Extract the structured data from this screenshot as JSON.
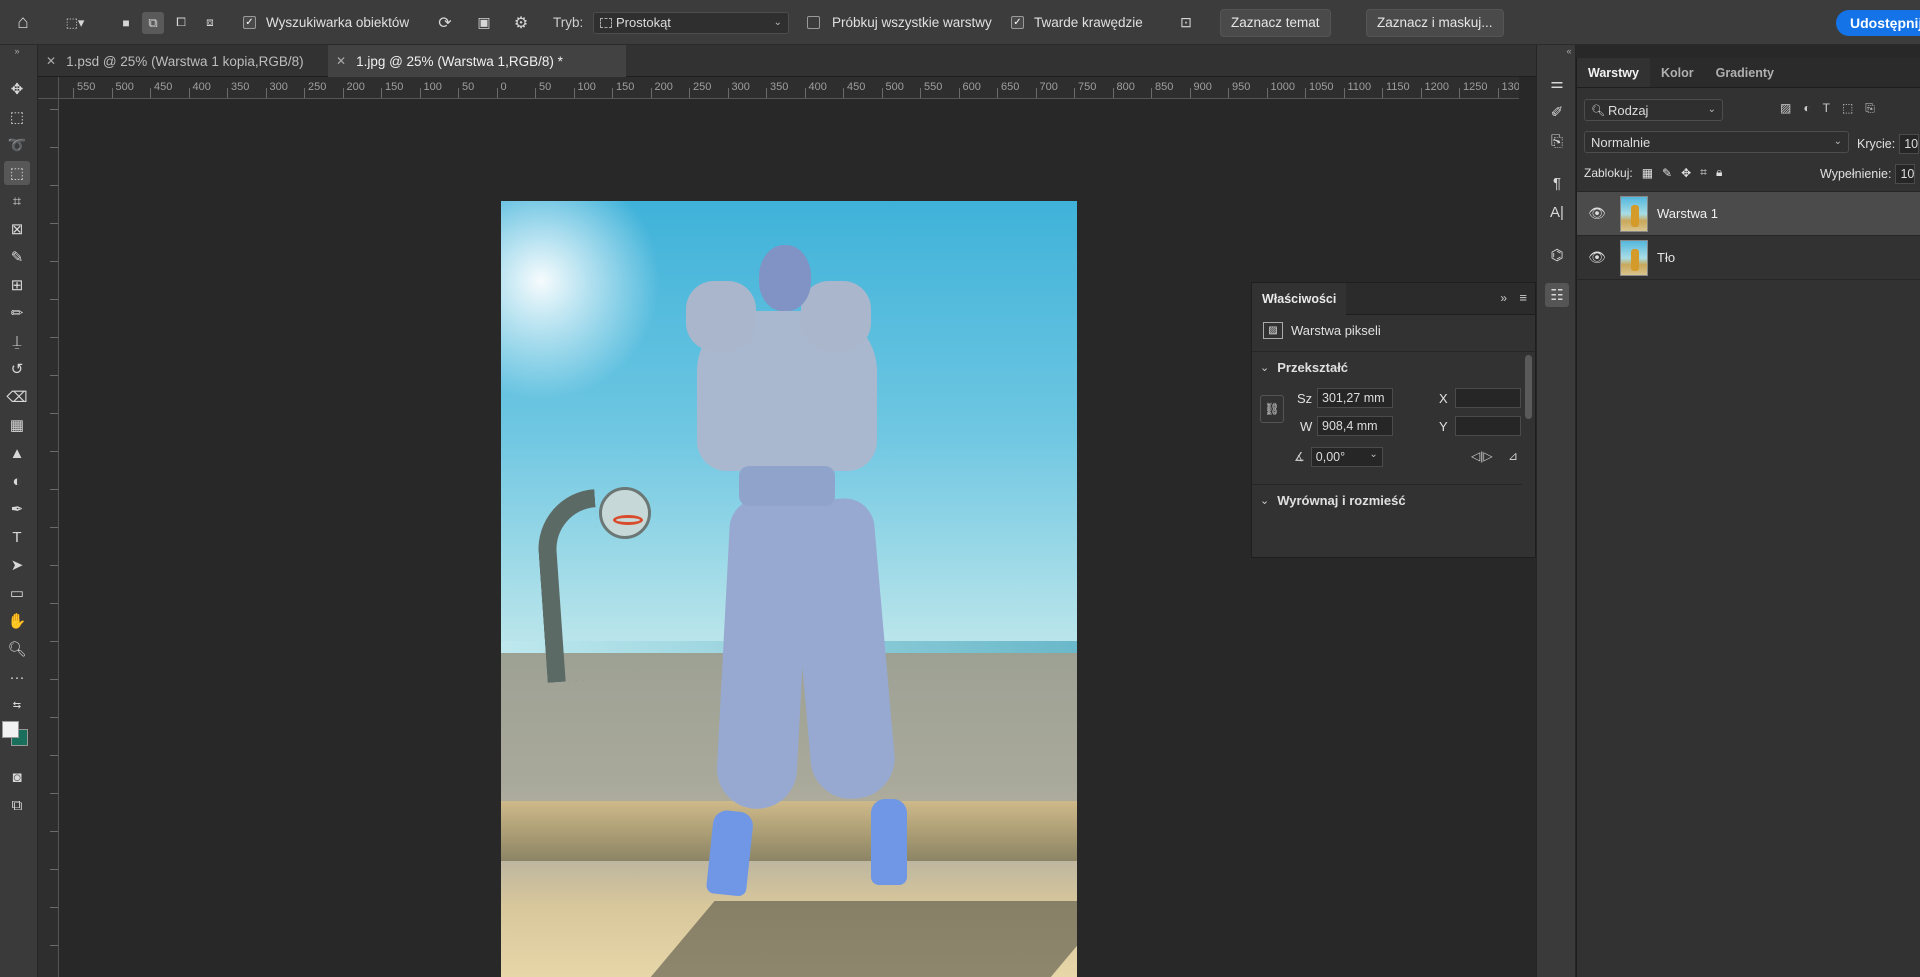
{
  "options_bar": {
    "object_finder_label": "Wyszukiwarka obiektów",
    "mode_label": "Tryb:",
    "mode_value": "Prostokąt",
    "sample_all_label": "Próbkuj wszystkie warstwy",
    "hard_edges_label": "Twarde krawędzie",
    "select_subject_label": "Zaznacz temat",
    "select_and_mask_label": "Zaznacz i maskuj...",
    "share_label": "Udostępnij"
  },
  "tabs": [
    {
      "label": "1.psd @ 25% (Warstwa 1 kopia,RGB/8)"
    },
    {
      "label": "1.jpg @ 25% (Warstwa 1,RGB/8) *"
    }
  ],
  "ruler_labels": [
    "550",
    "500",
    "450",
    "400",
    "350",
    "300",
    "250",
    "200",
    "150",
    "100",
    "50",
    "0",
    "50",
    "100",
    "150",
    "200",
    "250",
    "300",
    "350",
    "400",
    "450",
    "500",
    "550",
    "600",
    "650",
    "700",
    "750",
    "800",
    "850",
    "900",
    "950",
    "1000",
    "1050",
    "1100",
    "1150",
    "1200",
    "1250",
    "130"
  ],
  "properties": {
    "title": "Właściwości",
    "layer_type": "Warstwa pikseli",
    "transform_section": "Przekształć",
    "w_label": "Sz",
    "w_value": "301,27 mm",
    "h_label": "W",
    "h_value": "908,4 mm",
    "x_label": "X",
    "y_label": "Y",
    "angle_value": "0,00°",
    "align_section": "Wyrównaj i rozmieść"
  },
  "layers_panel": {
    "tabs": [
      "Warstwy",
      "Kolor",
      "Gradienty"
    ],
    "filter_value": "Rodzaj",
    "blend_mode": "Normalnie",
    "opacity_label": "Krycie:",
    "opacity_value": "10",
    "lock_label": "Zablokuj:",
    "fill_label": "Wypełnienie:",
    "fill_value": "10",
    "layers": [
      {
        "name": "Warstwa 1",
        "active": true
      },
      {
        "name": "Tło",
        "active": false
      }
    ]
  },
  "colors": {
    "accent": "#1473e6",
    "foreground_swatch": "#f2f2f2",
    "background_swatch": "#1a6f5c"
  }
}
